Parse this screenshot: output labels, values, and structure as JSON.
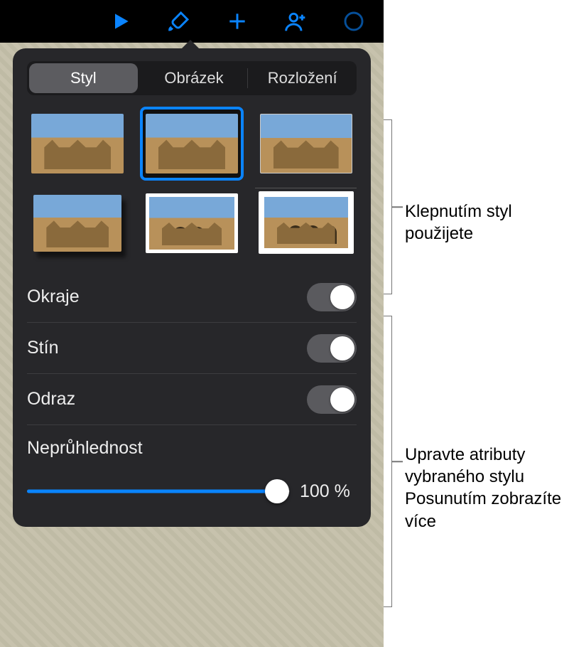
{
  "toolbar": {
    "icons": [
      "play-icon",
      "format-brush-icon",
      "add-icon",
      "add-person-icon",
      "more-icon"
    ]
  },
  "tabs": {
    "style": "Styl",
    "image": "Obrázek",
    "layout": "Rozložení",
    "active": "style"
  },
  "styles_grid": {
    "selected_index": 1,
    "count": 6
  },
  "rows": {
    "borders": {
      "label": "Okraje",
      "on": false
    },
    "shadow": {
      "label": "Stín",
      "on": false
    },
    "reflect": {
      "label": "Odraz",
      "on": false
    }
  },
  "opacity": {
    "label": "Neprůhlednost",
    "value_pct": 100,
    "display": "100 %"
  },
  "callouts": {
    "c1": "Klepnutím styl použijete",
    "c2": "Upravte atributy vybraného stylu Posunutím zobrazíte více"
  }
}
